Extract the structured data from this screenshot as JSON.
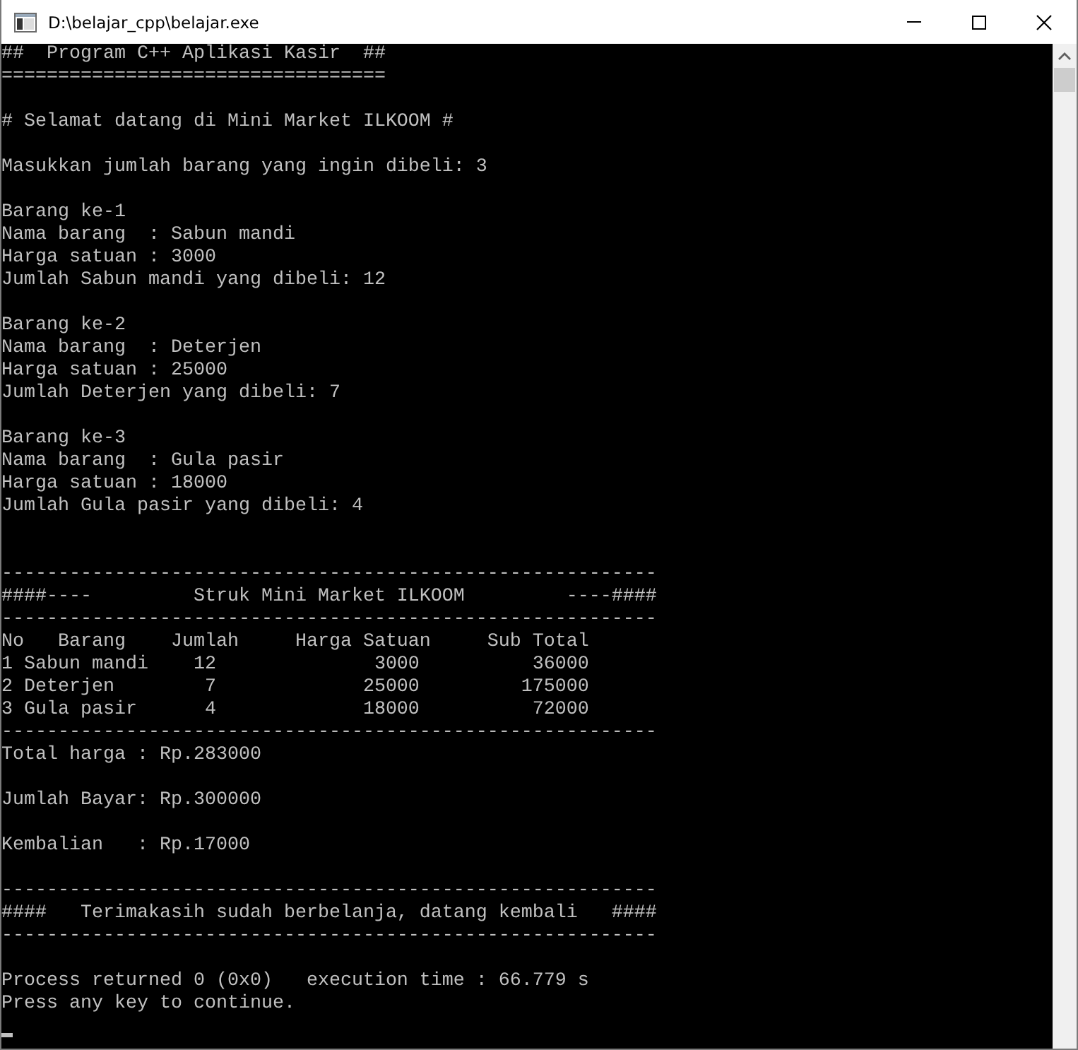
{
  "window": {
    "title": "D:\\belajar_cpp\\belajar.exe"
  },
  "console": {
    "lines": [
      {
        "kind": "text",
        "text": "##  Program C++ Aplikasi Kasir  ##"
      },
      {
        "kind": "text",
        "text": "=================================="
      },
      {
        "kind": "blank"
      },
      {
        "kind": "text",
        "text": "# Selamat datang di Mini Market ILKOOM #"
      },
      {
        "kind": "blank"
      },
      {
        "kind": "text",
        "text": "Masukkan jumlah barang yang ingin dibeli: 3"
      },
      {
        "kind": "blank"
      },
      {
        "kind": "text",
        "text": "Barang ke-1"
      },
      {
        "kind": "text",
        "text": "Nama barang  : Sabun mandi"
      },
      {
        "kind": "text",
        "text": "Harga satuan : 3000"
      },
      {
        "kind": "text",
        "text": "Jumlah Sabun mandi yang dibeli: 12"
      },
      {
        "kind": "blank"
      },
      {
        "kind": "text",
        "text": "Barang ke-2"
      },
      {
        "kind": "text",
        "text": "Nama barang  : Deterjen"
      },
      {
        "kind": "text",
        "text": "Harga satuan : 25000"
      },
      {
        "kind": "text",
        "text": "Jumlah Deterjen yang dibeli: 7"
      },
      {
        "kind": "blank"
      },
      {
        "kind": "text",
        "text": "Barang ke-3"
      },
      {
        "kind": "text",
        "text": "Nama barang  : Gula pasir"
      },
      {
        "kind": "text",
        "text": "Harga satuan : 18000"
      },
      {
        "kind": "text",
        "text": "Jumlah Gula pasir yang dibeli: 4"
      },
      {
        "kind": "blank"
      },
      {
        "kind": "blank"
      },
      {
        "kind": "text",
        "text": "----------------------------------------------------------"
      },
      {
        "kind": "text",
        "text": "####----         Struk Mini Market ILKOOM         ----####"
      },
      {
        "kind": "text",
        "text": "----------------------------------------------------------"
      },
      {
        "kind": "text",
        "text": "No   Barang    Jumlah     Harga Satuan     Sub Total"
      },
      {
        "kind": "text",
        "text": "1 Sabun mandi    12              3000          36000"
      },
      {
        "kind": "text",
        "text": "2 Deterjen        7             25000         175000"
      },
      {
        "kind": "text",
        "text": "3 Gula pasir      4             18000          72000"
      },
      {
        "kind": "text",
        "text": "----------------------------------------------------------"
      },
      {
        "kind": "text",
        "text": "Total harga : Rp.283000"
      },
      {
        "kind": "blank"
      },
      {
        "kind": "text",
        "text": "Jumlah Bayar: Rp.300000"
      },
      {
        "kind": "blank"
      },
      {
        "kind": "text",
        "text": "Kembalian   : Rp.17000"
      },
      {
        "kind": "blank"
      },
      {
        "kind": "text",
        "text": "----------------------------------------------------------"
      },
      {
        "kind": "text",
        "text": "####   Terimakasih sudah berbelanja, datang kembali   ####"
      },
      {
        "kind": "text",
        "text": "----------------------------------------------------------"
      },
      {
        "kind": "blank"
      },
      {
        "kind": "text",
        "text": "Process returned 0 (0x0)   execution time : 66.779 s"
      },
      {
        "kind": "text",
        "text": "Press any key to continue."
      },
      {
        "kind": "cursor"
      }
    ]
  }
}
